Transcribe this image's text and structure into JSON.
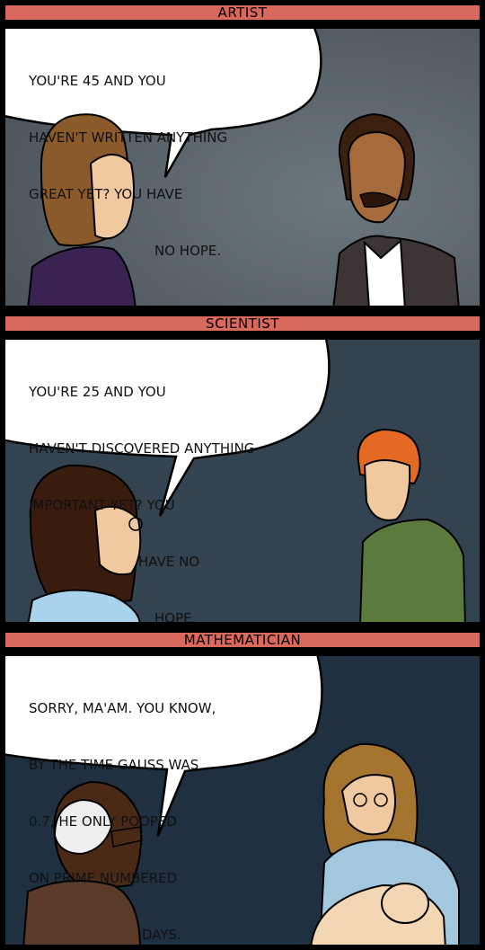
{
  "panels": [
    {
      "title": "ARTIST",
      "lines": [
        "YOU'RE 45 AND YOU",
        "HAVEN'T WRITTEN ANYTHING",
        "GREAT YET? YOU HAVE",
        "NO HOPE."
      ],
      "bg": "#5f6a70"
    },
    {
      "title": "SCIENTIST",
      "lines": [
        "YOU'RE 25 AND YOU",
        "HAVEN'T DISCOVERED ANYTHING",
        "IMPORTANT YET? YOU",
        "HAVE NO",
        "HOPE."
      ],
      "bg": "#2f3f4c"
    },
    {
      "title": "MATHEMATICIAN",
      "lines": [
        "SORRY, MA'AM. YOU KNOW,",
        "BY THE TIME GAUSS WAS",
        "0.7, HE ONLY POOPED",
        "ON PRIME NUMBERED",
        "DAYS."
      ],
      "bg": "#1e2f3d"
    }
  ],
  "colors": {
    "header": "#d9695c",
    "panel_border": "#000000"
  }
}
